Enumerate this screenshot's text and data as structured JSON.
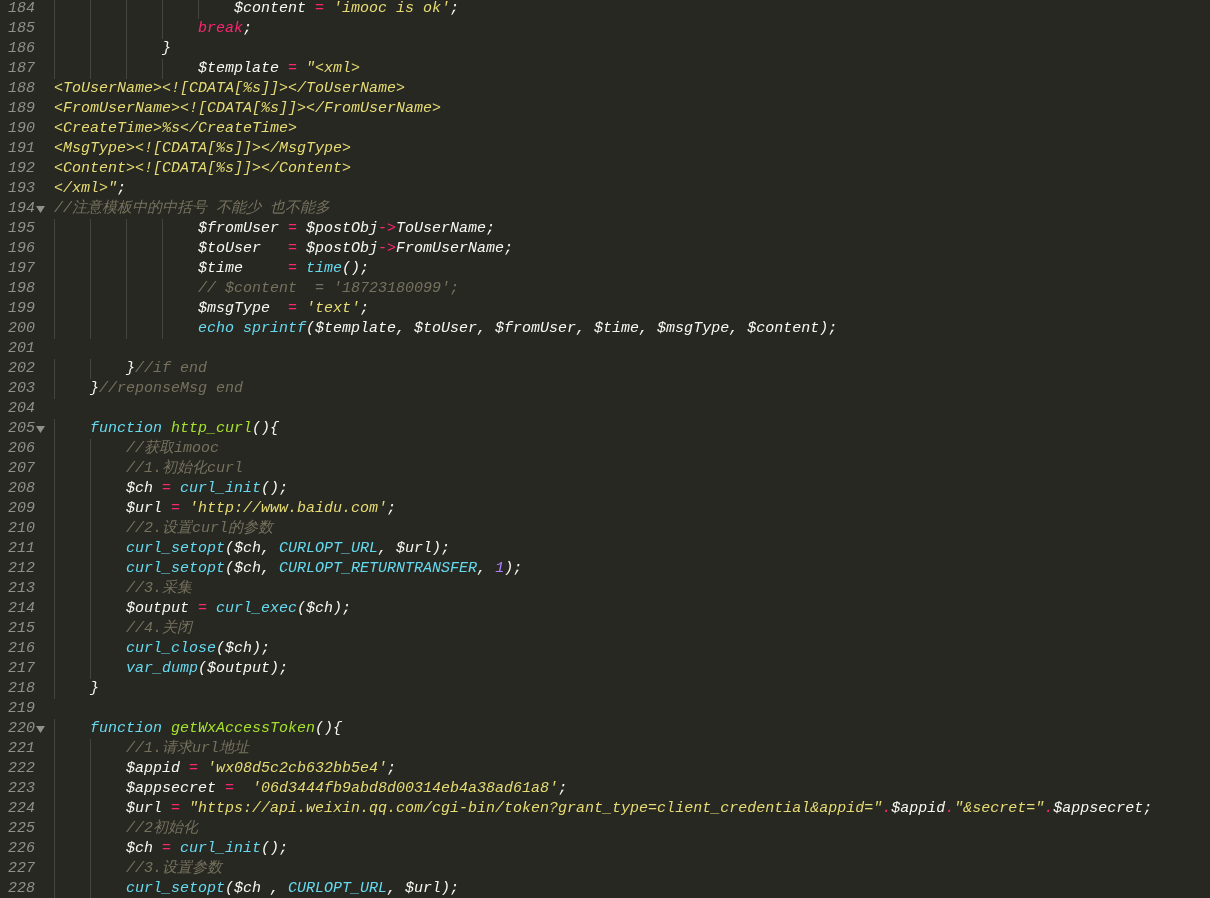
{
  "editor": {
    "lines": [
      {
        "number": "184",
        "fold": false,
        "tokens": [
          {
            "kind": "variable",
            "text": "\t\t\t\t\t$content "
          },
          {
            "kind": "operator",
            "text": "= "
          },
          {
            "kind": "string",
            "text": "'imooc is ok'"
          },
          {
            "kind": "plain",
            "text": ";"
          }
        ]
      },
      {
        "number": "185",
        "fold": false,
        "tokens": [
          {
            "kind": "keyword",
            "text": "\t\t\t\tbreak"
          },
          {
            "kind": "plain",
            "text": ";"
          }
        ]
      },
      {
        "number": "186",
        "fold": false,
        "tokens": [
          {
            "kind": "plain",
            "text": "\t\t\t}"
          }
        ]
      },
      {
        "number": "187",
        "fold": false,
        "tokens": [
          {
            "kind": "variable",
            "text": "\t\t\t\t$template "
          },
          {
            "kind": "operator",
            "text": "= "
          },
          {
            "kind": "string",
            "text": "\"<xml>"
          }
        ]
      },
      {
        "number": "188",
        "fold": false,
        "tokens": [
          {
            "kind": "string",
            "text": "<ToUserName><![CDATA[%s]]></ToUserName>"
          }
        ]
      },
      {
        "number": "189",
        "fold": false,
        "tokens": [
          {
            "kind": "string",
            "text": "<FromUserName><![CDATA[%s]]></FromUserName>"
          }
        ]
      },
      {
        "number": "190",
        "fold": false,
        "tokens": [
          {
            "kind": "string",
            "text": "<CreateTime>%s</CreateTime>"
          }
        ]
      },
      {
        "number": "191",
        "fold": false,
        "tokens": [
          {
            "kind": "string",
            "text": "<MsgType><![CDATA[%s]]></MsgType>"
          }
        ]
      },
      {
        "number": "192",
        "fold": false,
        "tokens": [
          {
            "kind": "string",
            "text": "<Content><![CDATA[%s]]></Content>"
          }
        ]
      },
      {
        "number": "193",
        "fold": false,
        "tokens": [
          {
            "kind": "string",
            "text": "</xml>\""
          },
          {
            "kind": "plain",
            "text": ";"
          }
        ]
      },
      {
        "number": "194",
        "fold": true,
        "tokens": [
          {
            "kind": "comment",
            "text": "//注意模板中的中括号 不能少 也不能多"
          }
        ]
      },
      {
        "number": "195",
        "fold": false,
        "tokens": [
          {
            "kind": "variable",
            "text": "\t\t\t\t$fromUser "
          },
          {
            "kind": "operator",
            "text": "= "
          },
          {
            "kind": "variable",
            "text": "$postObj"
          },
          {
            "kind": "operator",
            "text": "->"
          },
          {
            "kind": "plain",
            "text": "ToUserName;"
          }
        ]
      },
      {
        "number": "196",
        "fold": false,
        "tokens": [
          {
            "kind": "variable",
            "text": "\t\t\t\t$toUser   "
          },
          {
            "kind": "operator",
            "text": "= "
          },
          {
            "kind": "variable",
            "text": "$postObj"
          },
          {
            "kind": "operator",
            "text": "->"
          },
          {
            "kind": "plain",
            "text": "FromUserName;"
          }
        ]
      },
      {
        "number": "197",
        "fold": false,
        "tokens": [
          {
            "kind": "variable",
            "text": "\t\t\t\t$time     "
          },
          {
            "kind": "operator",
            "text": "= "
          },
          {
            "kind": "builtin",
            "text": "time"
          },
          {
            "kind": "plain",
            "text": "();"
          }
        ]
      },
      {
        "number": "198",
        "fold": false,
        "tokens": [
          {
            "kind": "comment",
            "text": "\t\t\t\t// $content  = '18723180099';"
          }
        ]
      },
      {
        "number": "199",
        "fold": false,
        "tokens": [
          {
            "kind": "variable",
            "text": "\t\t\t\t$msgType  "
          },
          {
            "kind": "operator",
            "text": "= "
          },
          {
            "kind": "string",
            "text": "'text'"
          },
          {
            "kind": "plain",
            "text": ";"
          }
        ]
      },
      {
        "number": "200",
        "fold": false,
        "tokens": [
          {
            "kind": "storage",
            "text": "\t\t\t\techo "
          },
          {
            "kind": "builtin",
            "text": "sprintf"
          },
          {
            "kind": "plain",
            "text": "($template, $toUser, $fromUser, $time, $msgType, $content);"
          }
        ]
      },
      {
        "number": "201",
        "fold": false
      },
      {
        "number": "202",
        "fold": false,
        "tokens": [
          {
            "kind": "plain",
            "text": "\t\t}"
          },
          {
            "kind": "comment",
            "text": "//if end"
          }
        ]
      },
      {
        "number": "203",
        "fold": false,
        "tokens": [
          {
            "kind": "plain",
            "text": "\t}"
          },
          {
            "kind": "comment",
            "text": "//reponseMsg end"
          }
        ]
      },
      {
        "number": "204",
        "fold": false
      },
      {
        "number": "205",
        "fold": true,
        "tokens": [
          {
            "kind": "storage",
            "text": "\tfunction "
          },
          {
            "kind": "function",
            "text": "http_curl"
          },
          {
            "kind": "plain",
            "text": "(){"
          }
        ]
      },
      {
        "number": "206",
        "fold": false,
        "tokens": [
          {
            "kind": "comment",
            "text": "\t\t//获取imooc"
          }
        ]
      },
      {
        "number": "207",
        "fold": false,
        "tokens": [
          {
            "kind": "comment",
            "text": "\t\t//1.初始化curl"
          }
        ]
      },
      {
        "number": "208",
        "fold": false,
        "tokens": [
          {
            "kind": "variable",
            "text": "\t\t$ch "
          },
          {
            "kind": "operator",
            "text": "= "
          },
          {
            "kind": "builtin",
            "text": "curl_init"
          },
          {
            "kind": "plain",
            "text": "();"
          }
        ]
      },
      {
        "number": "209",
        "fold": false,
        "tokens": [
          {
            "kind": "variable",
            "text": "\t\t$url "
          },
          {
            "kind": "operator",
            "text": "= "
          },
          {
            "kind": "string",
            "text": "'http://www.baidu.com'"
          },
          {
            "kind": "plain",
            "text": ";"
          }
        ]
      },
      {
        "number": "210",
        "fold": false,
        "tokens": [
          {
            "kind": "comment",
            "text": "\t\t//2.设置curl的参数"
          }
        ]
      },
      {
        "number": "211",
        "fold": false,
        "tokens": [
          {
            "kind": "builtin",
            "text": "\t\tcurl_setopt"
          },
          {
            "kind": "plain",
            "text": "($ch, "
          },
          {
            "kind": "constant",
            "text": "CURLOPT_URL"
          },
          {
            "kind": "plain",
            "text": ", $url);"
          }
        ]
      },
      {
        "number": "212",
        "fold": false,
        "tokens": [
          {
            "kind": "builtin",
            "text": "\t\tcurl_setopt"
          },
          {
            "kind": "plain",
            "text": "($ch, "
          },
          {
            "kind": "constant",
            "text": "CURLOPT_RETURNTRANSFER"
          },
          {
            "kind": "plain",
            "text": ", "
          },
          {
            "kind": "number",
            "text": "1"
          },
          {
            "kind": "plain",
            "text": ");"
          }
        ]
      },
      {
        "number": "213",
        "fold": false,
        "tokens": [
          {
            "kind": "comment",
            "text": "\t\t//3.采集"
          }
        ]
      },
      {
        "number": "214",
        "fold": false,
        "tokens": [
          {
            "kind": "variable",
            "text": "\t\t$output "
          },
          {
            "kind": "operator",
            "text": "= "
          },
          {
            "kind": "builtin",
            "text": "curl_exec"
          },
          {
            "kind": "plain",
            "text": "($ch);"
          }
        ]
      },
      {
        "number": "215",
        "fold": false,
        "tokens": [
          {
            "kind": "comment",
            "text": "\t\t//4.关闭"
          }
        ]
      },
      {
        "number": "216",
        "fold": false,
        "tokens": [
          {
            "kind": "builtin",
            "text": "\t\tcurl_close"
          },
          {
            "kind": "plain",
            "text": "($ch);"
          }
        ]
      },
      {
        "number": "217",
        "fold": false,
        "tokens": [
          {
            "kind": "builtin",
            "text": "\t\tvar_dump"
          },
          {
            "kind": "plain",
            "text": "($output);"
          }
        ]
      },
      {
        "number": "218",
        "fold": false,
        "tokens": [
          {
            "kind": "plain",
            "text": "\t}"
          }
        ]
      },
      {
        "number": "219",
        "fold": false
      },
      {
        "number": "220",
        "fold": true,
        "tokens": [
          {
            "kind": "storage",
            "text": "\tfunction "
          },
          {
            "kind": "function",
            "text": "getWxAccessToken"
          },
          {
            "kind": "plain",
            "text": "(){"
          }
        ]
      },
      {
        "number": "221",
        "fold": false,
        "tokens": [
          {
            "kind": "comment",
            "text": "\t\t//1.请求url地址"
          }
        ]
      },
      {
        "number": "222",
        "fold": false,
        "tokens": [
          {
            "kind": "variable",
            "text": "\t\t$appid "
          },
          {
            "kind": "operator",
            "text": "= "
          },
          {
            "kind": "string",
            "text": "'wx08d5c2cb632bb5e4'"
          },
          {
            "kind": "plain",
            "text": ";"
          }
        ]
      },
      {
        "number": "223",
        "fold": false,
        "tokens": [
          {
            "kind": "variable",
            "text": "\t\t$appsecret "
          },
          {
            "kind": "operator",
            "text": "=  "
          },
          {
            "kind": "string",
            "text": "'06d3444fb9abd8d00314eb4a38ad61a8'"
          },
          {
            "kind": "plain",
            "text": ";"
          }
        ]
      },
      {
        "number": "224",
        "fold": false,
        "tokens": [
          {
            "kind": "variable",
            "text": "\t\t$url "
          },
          {
            "kind": "operator",
            "text": "= "
          },
          {
            "kind": "string",
            "text": "\"https://api.weixin.qq.com/cgi-bin/token?grant_type=client_credential&appid=\""
          },
          {
            "kind": "operator",
            "text": "."
          },
          {
            "kind": "variable",
            "text": "$appid"
          },
          {
            "kind": "operator",
            "text": "."
          },
          {
            "kind": "string",
            "text": "\"&secret=\""
          },
          {
            "kind": "operator",
            "text": "."
          },
          {
            "kind": "variable",
            "text": "$appsecret"
          },
          {
            "kind": "plain",
            "text": ";"
          }
        ]
      },
      {
        "number": "225",
        "fold": false,
        "tokens": [
          {
            "kind": "comment",
            "text": "\t\t//2初始化"
          }
        ]
      },
      {
        "number": "226",
        "fold": false,
        "tokens": [
          {
            "kind": "variable",
            "text": "\t\t$ch "
          },
          {
            "kind": "operator",
            "text": "= "
          },
          {
            "kind": "builtin",
            "text": "curl_init"
          },
          {
            "kind": "plain",
            "text": "();"
          }
        ]
      },
      {
        "number": "227",
        "fold": false,
        "tokens": [
          {
            "kind": "comment",
            "text": "\t\t//3.设置参数"
          }
        ]
      },
      {
        "number": "228",
        "fold": false,
        "tokens": [
          {
            "kind": "builtin",
            "text": "\t\tcurl_setopt"
          },
          {
            "kind": "plain",
            "text": "($ch , "
          },
          {
            "kind": "constant",
            "text": "CURLOPT_URL"
          },
          {
            "kind": "plain",
            "text": ", $url);"
          }
        ]
      }
    ]
  }
}
